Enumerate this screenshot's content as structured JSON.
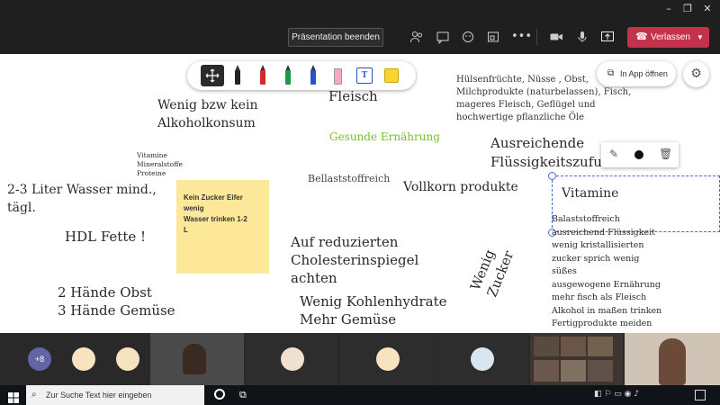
{
  "call": {
    "stop_presenting_label": "Präsentation beenden",
    "leave_label": "Verlassen"
  },
  "whiteboard": {
    "open_in_app_label": "In App öffnen",
    "texts": {
      "alcohol": "Wenig bzw kein\nAlkoholkonsum",
      "meat": "Fleisch",
      "legumes": "Hülsenfrüchte, Nüsse , Obst,\nMilchprodukte (naturbelassen), Fisch,\nmageres Fleisch, Geflügel und\nhochwertige pflanzliche Öle",
      "healthy_title": "Gesunde Ernährung",
      "vitamins_small": "Vitamine\nMineralstoffe\nProteine",
      "fluids": "Ausreichende\nFlüssigkeitszufuhr",
      "water": "2-3 Liter Wasser mind.,\ntägl.",
      "fiber": "Bellaststoffreich",
      "wholegrain": "Vollkorn produkte",
      "hdl": "HDL Fette !",
      "cholesterol": "Auf reduzierten\nCholesterinspiegel\nachten",
      "fruit_veg": "2 Hände Obst\n3 Hände Gemüse",
      "carbs": "Wenig Kohlenhydrate\nMehr Gemüse",
      "sugar_rot": "Wenig\nZucker"
    },
    "sticky_note": "Kein Zucker Eifer\nwenig\nWasser trinken 1-2\nL",
    "vitamin_box": {
      "title": "Vitamine",
      "lines": [
        "Balaststoffreich",
        "ausreichend Flüssigkeit",
        "wenig kristallisierten",
        "zucker sprich wenig",
        "süßes",
        "ausgewogene Ernährung",
        "mehr fisch als Fleisch",
        "Alkohol in maßen trinken",
        "Fertigprodukte meiden"
      ]
    }
  },
  "participants": {
    "more_count": "+8"
  },
  "taskbar": {
    "search_placeholder": "Zur Suche Text hier eingeben"
  },
  "colors": {
    "leave": "#c4314b",
    "healthy_title": "#7bbf2a",
    "sticky": "#fde89a",
    "more_badge": "#6264a7"
  }
}
